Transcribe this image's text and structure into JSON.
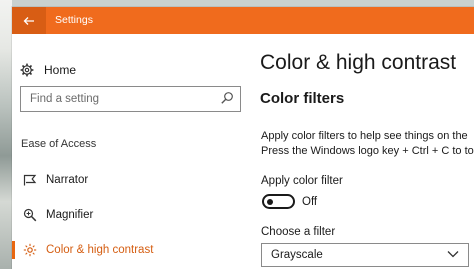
{
  "window": {
    "title": "Settings"
  },
  "nav": {
    "home_label": "Home",
    "search_placeholder": "Find a setting",
    "section_label": "Ease of Access",
    "items": [
      {
        "label": "Narrator",
        "icon": "narrator-icon",
        "active": false
      },
      {
        "label": "Magnifier",
        "icon": "magnifier-icon",
        "active": false
      },
      {
        "label": "Color & high contrast",
        "icon": "brightness-icon",
        "active": true
      }
    ]
  },
  "content": {
    "page_title": "Color & high contrast",
    "section_title": "Color filters",
    "description_line1": "Apply color filters to help see things on the",
    "description_line2": "Press the Windows logo key + Ctrl + C to tog",
    "apply_label": "Apply color filter",
    "toggle_state": "Off",
    "choose_label": "Choose a filter",
    "filter_selected": "Grayscale"
  },
  "colors": {
    "accent": "#f06b1d",
    "accent_text": "#d55e12"
  }
}
